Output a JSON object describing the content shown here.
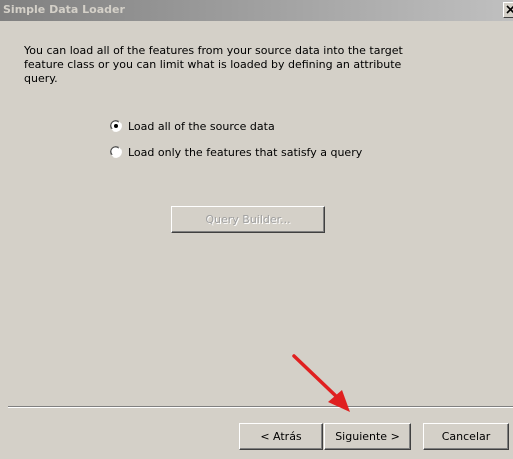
{
  "window": {
    "title": "Simple Data Loader",
    "close_label": "X"
  },
  "intro": {
    "text": "You can load all of the features from your source data into the target\nfeature class or you can limit what is loaded by defining an attribute\nquery."
  },
  "options": [
    {
      "label": "Load all of the source data",
      "selected": true
    },
    {
      "label": "Load only the features that satisfy a query",
      "selected": false
    }
  ],
  "query_builder": {
    "label": "Query Builder...",
    "enabled": false
  },
  "footer": {
    "back_label": "< Atrás",
    "next_label": "Siguiente >",
    "cancel_label": "Cancelar"
  },
  "annotation": {
    "arrow_color": "#e02020"
  }
}
